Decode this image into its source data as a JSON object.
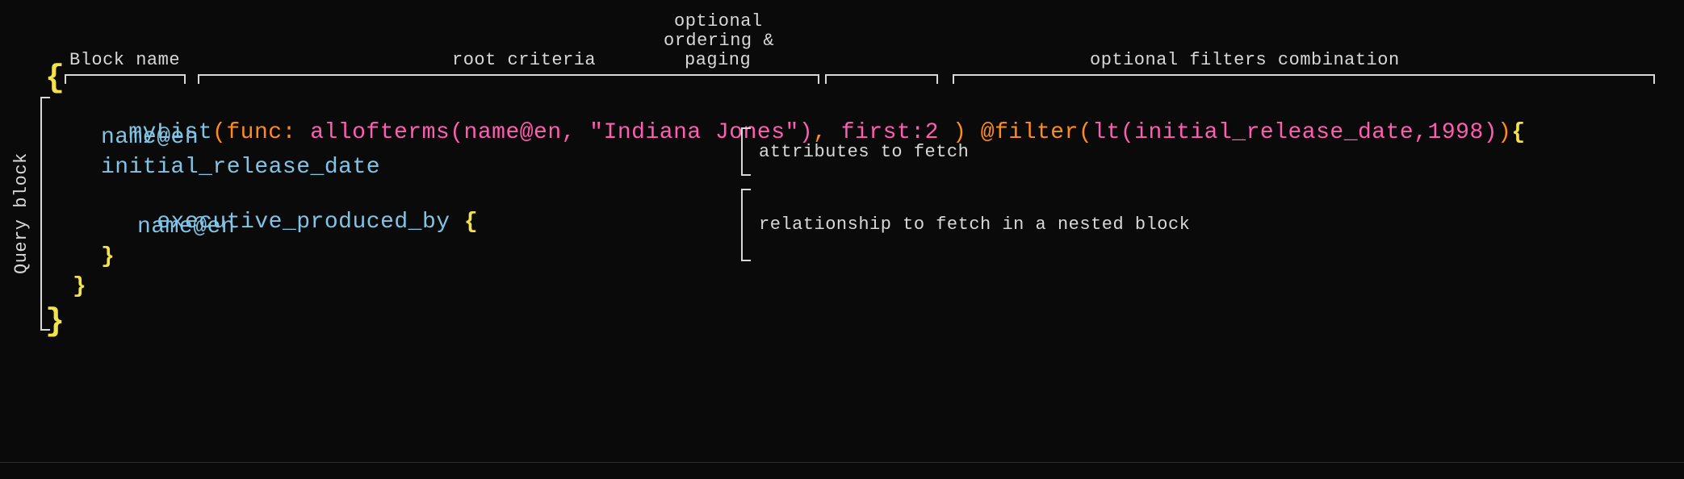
{
  "annotations": {
    "block_name": "Block name",
    "root_criteria": "root criteria",
    "optional_paging_l1": "optional",
    "optional_paging_l2": "ordering &",
    "optional_paging_l3": "paging",
    "filters_combo": "optional filters combination",
    "query_block": "Query block",
    "attrs_to_fetch": "attributes to fetch",
    "rel_to_fetch": "relationship to fetch in a nested block"
  },
  "code": {
    "open_brace": "{",
    "line1_myList": "myList",
    "line1_paren_open": "(",
    "line1_func_kw": "func:",
    "line1_space1": " ",
    "line1_allofterms": "allofterms",
    "line1_args_paren_open": "(",
    "line1_arg_name": "name@en",
    "line1_comma1": ", ",
    "line1_string": "\"Indiana Jones\"",
    "line1_args_paren_close": ")",
    "line1_comma2": ", ",
    "line1_first_kw": "first:",
    "line1_first_val": "2 ",
    "line1_paren_close": ")",
    "line1_space2": " ",
    "line1_atfilter": "@filter",
    "line1_f_paren_open": "(",
    "line1_lt": "lt",
    "line1_lt_paren_open": "(",
    "line1_lt_arg1": "initial_release_date",
    "line1_lt_comma": ",",
    "line1_lt_arg2": "1998",
    "line1_lt_paren_close": ")",
    "line1_f_paren_close": ")",
    "line1_open_brace": "{",
    "line2": "name@en",
    "line3": "initial_release_date",
    "line4_name": "executive_produced_by ",
    "line4_brace": "{",
    "line5": "name@en",
    "line6_brace": "}",
    "line7_brace": "}",
    "close_brace": "}"
  }
}
